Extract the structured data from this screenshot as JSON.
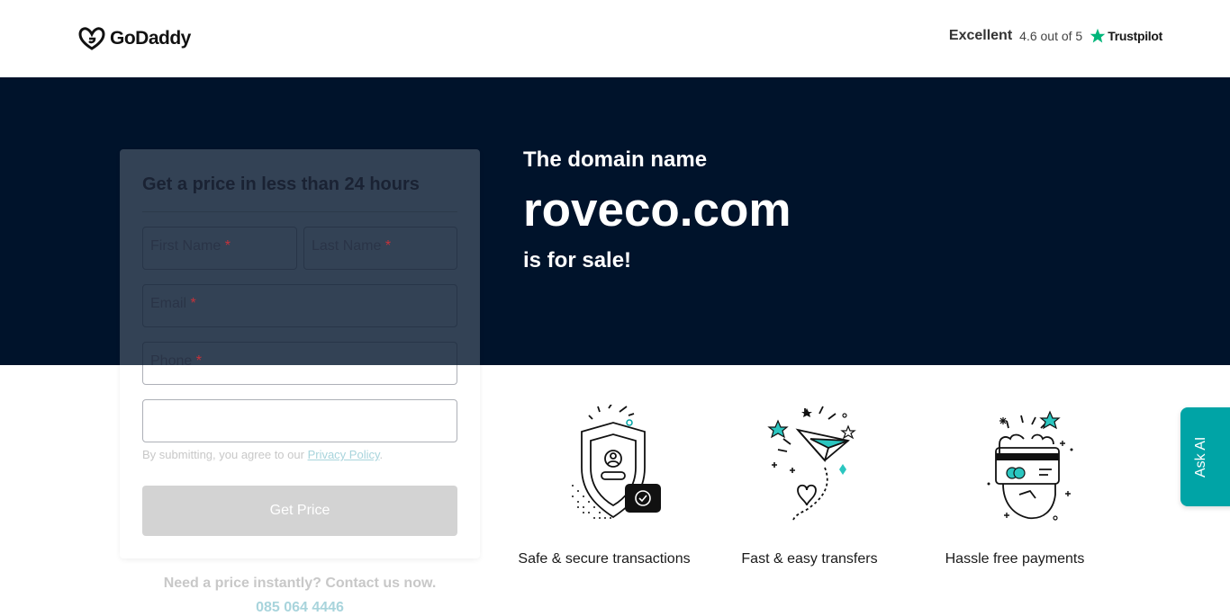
{
  "header": {
    "brand": "GoDaddy",
    "trustpilot": {
      "rating_word": "Excellent",
      "score_text": "4.6 out of 5",
      "brand": "Trustpilot",
      "star_color": "#00b67a"
    }
  },
  "hero": {
    "pre": "The domain name",
    "domain": "roveco.com",
    "post": "is for sale!",
    "background": "#00132b"
  },
  "form": {
    "title": "Get a price in less than 24 hours",
    "first_name": "First Name",
    "last_name": "Last Name",
    "email": "Email",
    "phone": "Phone",
    "required_mark": "*",
    "note_prefix": "By submitting, you agree to our",
    "note_link": "Privacy Policy",
    "note_suffix": ".",
    "submit": "Get Price"
  },
  "contact": {
    "text": "Need a price instantly? Contact us now.",
    "phone": "085 064 4446"
  },
  "features": [
    {
      "icon": "shield-icon",
      "label": "Safe & secure transactions"
    },
    {
      "icon": "paper-plane-icon",
      "label": "Fast & easy transfers"
    },
    {
      "icon": "credit-card-icon",
      "label": "Hassle free payments"
    }
  ],
  "ask_ai": {
    "label": "Ask AI",
    "color": "#00a4a6"
  }
}
